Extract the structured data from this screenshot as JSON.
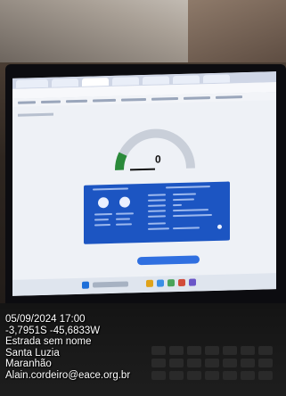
{
  "photo": {
    "subject": "laptop-screen-with-speed-test"
  },
  "screen": {
    "gauge": {
      "value": "0"
    }
  },
  "overlay": {
    "datetime": "05/09/2024 17:00",
    "coordinates": "-3,7951S -45,6833W",
    "road": "Estrada sem nome",
    "city": "Santa Luzia",
    "state": "Maranhão",
    "email": "Alain.cordeiro@eace.org.br"
  }
}
